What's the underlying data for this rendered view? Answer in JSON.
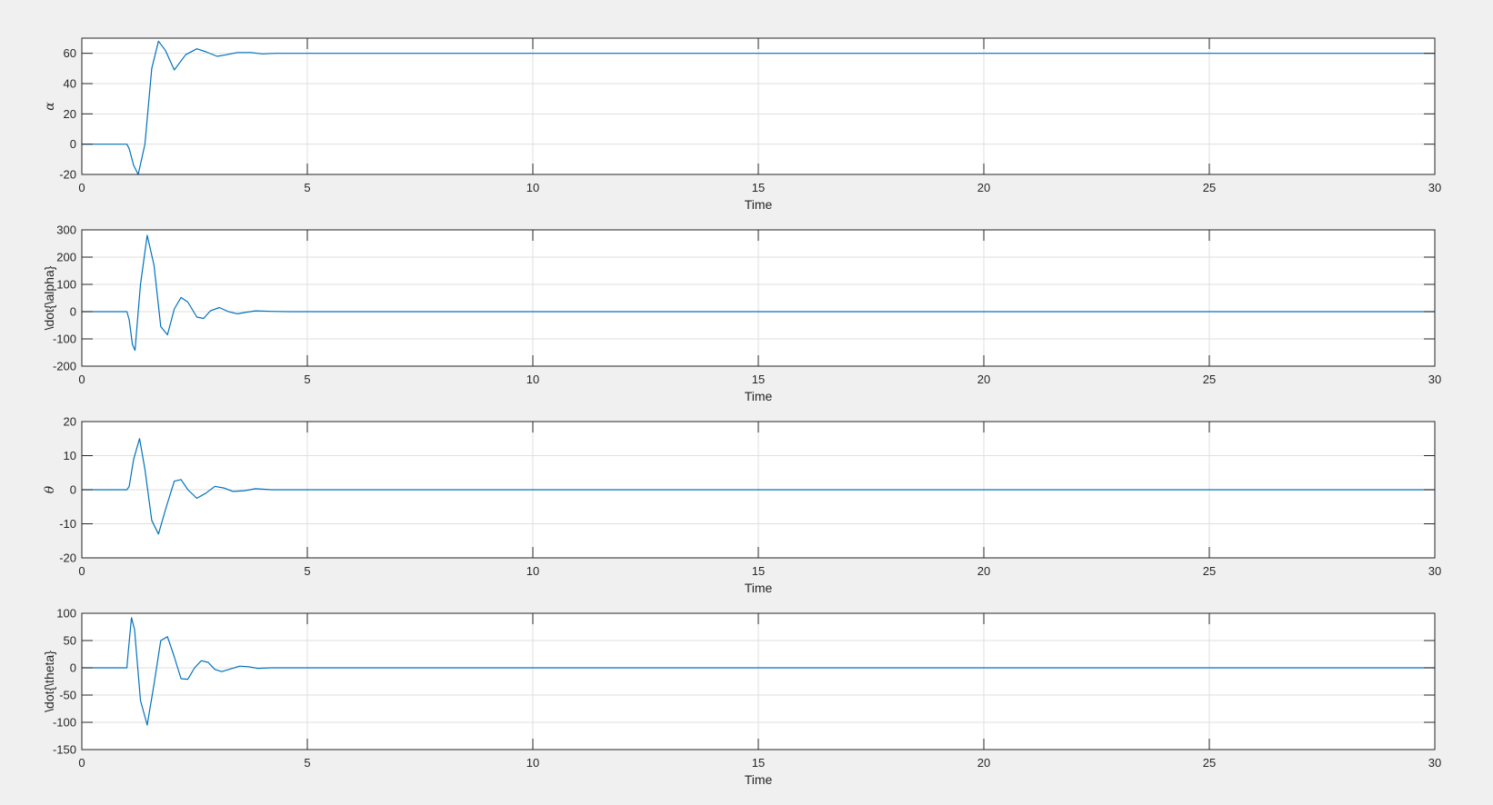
{
  "figure": {
    "background": "#f0f0f0",
    "line_color": "#0072bd",
    "grid_color": "#dfdfdf"
  },
  "chart_data": [
    {
      "type": "line",
      "title": "",
      "xlabel": "Time",
      "ylabel": "α",
      "xlim": [
        0,
        30
      ],
      "ylim": [
        -20,
        70
      ],
      "xticks": [
        0,
        5,
        10,
        15,
        20,
        25,
        30
      ],
      "yticks": [
        -20,
        0,
        20,
        40,
        60
      ],
      "grid": true,
      "series": [
        {
          "x": [
            0,
            1.0,
            1.05,
            1.15,
            1.25,
            1.4,
            1.55,
            1.7,
            1.85,
            2.05,
            2.3,
            2.55,
            2.75,
            3.0,
            3.2,
            3.45,
            3.75,
            4.0,
            4.3,
            4.6,
            5.0,
            6.0,
            10,
            15,
            20,
            25,
            30
          ],
          "y": [
            0,
            0,
            -3,
            -14,
            -20,
            0,
            50,
            68,
            62,
            49,
            59,
            63,
            61,
            58,
            59,
            60.5,
            60.5,
            59.6,
            60,
            60,
            60,
            60,
            60,
            60,
            60,
            60,
            60
          ]
        }
      ]
    },
    {
      "type": "line",
      "title": "",
      "xlabel": "Time",
      "ylabel": "\\dot{\\alpha}",
      "xlim": [
        0,
        30
      ],
      "ylim": [
        -200,
        300
      ],
      "xticks": [
        0,
        5,
        10,
        15,
        20,
        25,
        30
      ],
      "yticks": [
        -200,
        -100,
        0,
        100,
        200,
        300
      ],
      "grid": true,
      "series": [
        {
          "x": [
            0,
            1.0,
            1.05,
            1.12,
            1.18,
            1.3,
            1.45,
            1.6,
            1.75,
            1.9,
            2.05,
            2.2,
            2.35,
            2.55,
            2.7,
            2.85,
            3.05,
            3.25,
            3.45,
            3.65,
            3.85,
            4.2,
            4.6,
            5.2,
            6,
            10,
            15,
            20,
            25,
            30
          ],
          "y": [
            0,
            0,
            -30,
            -120,
            -142,
            100,
            280,
            170,
            -55,
            -85,
            10,
            52,
            35,
            -20,
            -25,
            3,
            15,
            0,
            -8,
            -2,
            3,
            1,
            0,
            0,
            0,
            0,
            0,
            0,
            0,
            0
          ]
        }
      ]
    },
    {
      "type": "line",
      "title": "",
      "xlabel": "Time",
      "ylabel": "θ",
      "xlim": [
        0,
        30
      ],
      "ylim": [
        -20,
        20
      ],
      "xticks": [
        0,
        5,
        10,
        15,
        20,
        25,
        30
      ],
      "yticks": [
        -20,
        -10,
        0,
        10,
        20
      ],
      "grid": true,
      "series": [
        {
          "x": [
            0,
            1.0,
            1.05,
            1.15,
            1.28,
            1.4,
            1.55,
            1.7,
            1.85,
            2.05,
            2.2,
            2.35,
            2.55,
            2.75,
            2.95,
            3.15,
            3.35,
            3.6,
            3.85,
            4.2,
            4.6,
            5.0,
            6,
            10,
            15,
            20,
            25,
            30
          ],
          "y": [
            0,
            0,
            1,
            9,
            15,
            6,
            -9,
            -13,
            -6,
            2.5,
            3,
            0,
            -2.5,
            -1,
            1,
            0.5,
            -0.5,
            -0.3,
            0.3,
            0,
            0,
            0,
            0,
            0,
            0,
            0,
            0,
            0
          ]
        }
      ]
    },
    {
      "type": "line",
      "title": "",
      "xlabel": "Time",
      "ylabel": "\\dot{\\theta}",
      "xlim": [
        0,
        30
      ],
      "ylim": [
        -150,
        100
      ],
      "xticks": [
        0,
        5,
        10,
        15,
        20,
        25,
        30
      ],
      "yticks": [
        -150,
        -100,
        -50,
        0,
        50,
        100
      ],
      "grid": true,
      "series": [
        {
          "x": [
            0,
            1.0,
            1.03,
            1.1,
            1.17,
            1.3,
            1.45,
            1.6,
            1.75,
            1.9,
            2.05,
            2.2,
            2.35,
            2.5,
            2.65,
            2.8,
            2.95,
            3.1,
            3.3,
            3.5,
            3.7,
            3.9,
            4.2,
            4.6,
            5.2,
            6,
            10,
            15,
            20,
            25,
            30
          ],
          "y": [
            0,
            0,
            30,
            92,
            70,
            -60,
            -105,
            -30,
            50,
            57,
            20,
            -20,
            -21,
            0,
            13,
            10,
            -3,
            -7,
            -2,
            3,
            2,
            -1,
            0,
            0,
            0,
            0,
            0,
            0,
            0,
            0,
            0
          ]
        }
      ]
    }
  ]
}
